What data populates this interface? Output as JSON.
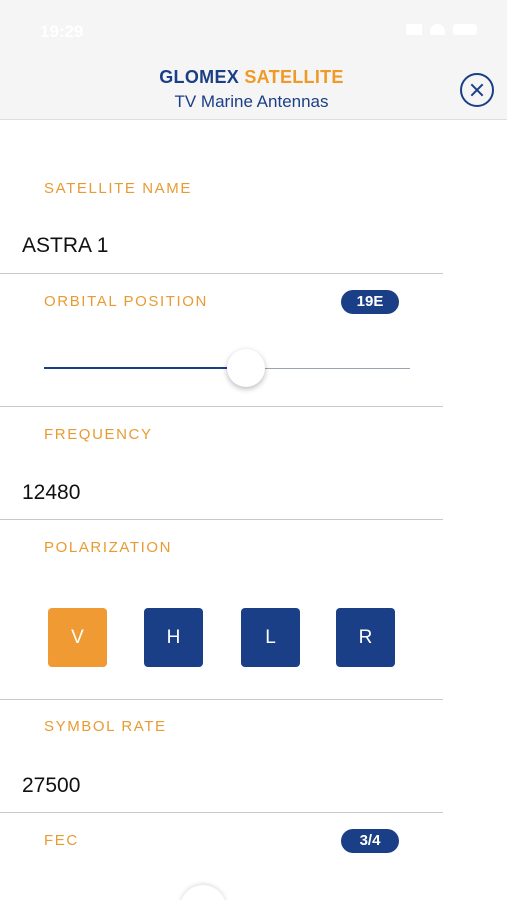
{
  "status": {
    "time": "19:29"
  },
  "header": {
    "brand_part1": "GLOMEX",
    "brand_part2": "SATELLITE",
    "subtitle": "TV Marine Antennas"
  },
  "fields": {
    "satellite_name": {
      "label": "SATELLITE NAME",
      "value": "ASTRA 1"
    },
    "orbital_position": {
      "label": "ORBITAL POSITION",
      "badge": "19E",
      "slider_fraction": 0.55
    },
    "frequency": {
      "label": "FREQUENCY",
      "value": "12480"
    },
    "polarization": {
      "label": "POLARIZATION",
      "options": [
        "V",
        "H",
        "L",
        "R"
      ],
      "selected": "V"
    },
    "symbol_rate": {
      "label": "SYMBOL RATE",
      "value": "27500"
    },
    "fec": {
      "label": "FEC",
      "badge": "3/4"
    }
  },
  "colors": {
    "accent": "#ef9a32",
    "primary": "#1b3f86",
    "background": "#ffffff"
  }
}
